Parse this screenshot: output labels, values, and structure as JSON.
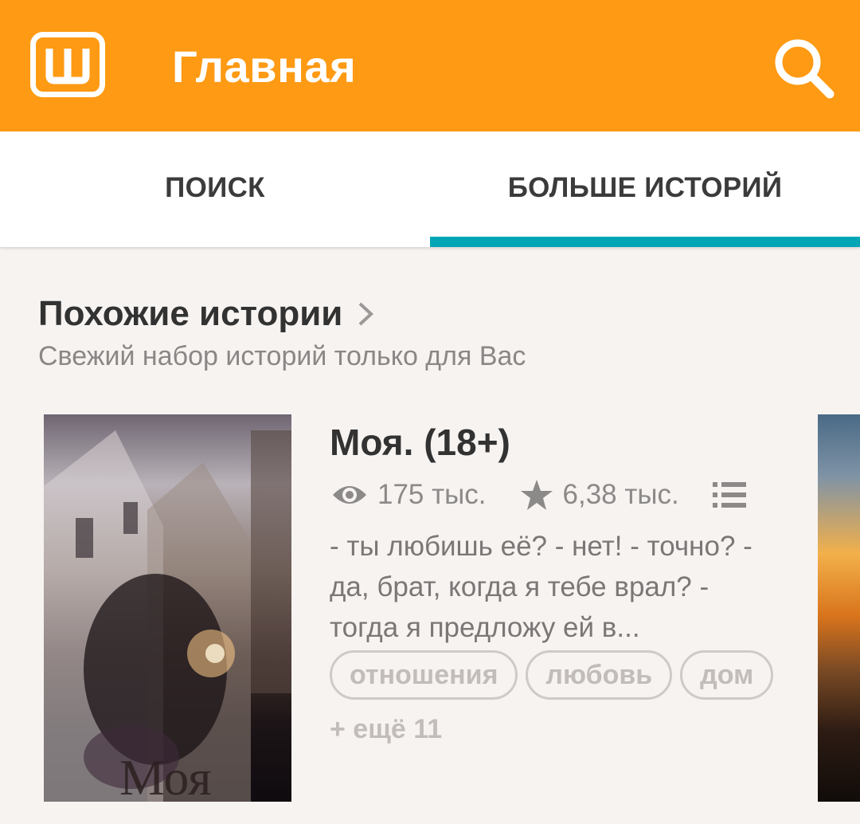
{
  "appbar": {
    "logo_icon": "wattpad-logo-icon",
    "title": "Главная",
    "search_icon": "search-icon",
    "color": "#fe9a13"
  },
  "tabs": [
    {
      "label": "ПОИСК",
      "selected": false
    },
    {
      "label": "БОЛЬШЕ ИСТОРИЙ",
      "selected": true
    }
  ],
  "tab_indicator_color": "#00a6b6",
  "section": {
    "title": "Похожие истории",
    "subtitle": "Свежий набор историй только для Вас"
  },
  "story": {
    "cover_text": "Моя",
    "title": "Моя. (18+)",
    "reads": "175 тыс.",
    "votes": "6,38 тыс.",
    "description": "- ты любишь её?  - нет!  - точно?  - да, брат, когда я тебе врал?  - тогда я предложу ей в...",
    "tags": [
      "отношения",
      "любовь",
      "дом"
    ],
    "more_tags": "+ ещё 11"
  }
}
